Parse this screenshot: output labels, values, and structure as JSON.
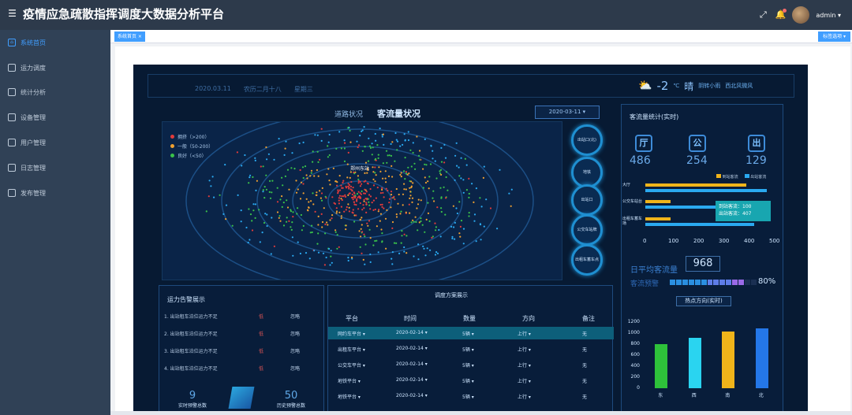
{
  "header": {
    "menu_icon": "hamburger-icon",
    "title": "疫情应急疏散指挥调度大数据分析平台",
    "user": "admin ▾",
    "icons": [
      "fullscreen-icon",
      "bell-icon",
      "avatar"
    ]
  },
  "sidebar": {
    "items": [
      {
        "label": "系统首页",
        "icon": "home-icon",
        "active": true
      },
      {
        "label": "运力调度",
        "icon": "transport-icon"
      },
      {
        "label": "统计分析",
        "icon": "stats-icon"
      },
      {
        "label": "设备管理",
        "icon": "device-icon"
      },
      {
        "label": "用户管理",
        "icon": "user-icon"
      },
      {
        "label": "日志管理",
        "icon": "log-icon"
      },
      {
        "label": "发布管理",
        "icon": "publish-icon"
      }
    ]
  },
  "tabs": {
    "home": "系统首页 ×",
    "close_label": "标签选项 ▾"
  },
  "dashboard": {
    "date": "2020.03.11",
    "lunar": "农历二月十八",
    "weekday": "星期三",
    "weather": {
      "temp": "-2",
      "unit": "℃",
      "cond": "晴",
      "extra1": "阴转小雨",
      "extra2": "西北风微风"
    },
    "tab_road": "道路状况",
    "tab_passenger": "客流量状况",
    "date_select": "2020-03-11 ▾",
    "map_label": "郑州东站",
    "map_legend": [
      {
        "label": "拥挤（>200）",
        "color": "#e23b3b"
      },
      {
        "label": "一般（50-200）",
        "color": "#f0a030"
      },
      {
        "label": "良好（<50）",
        "color": "#3ac24a"
      }
    ],
    "stations": [
      "出站口(北)",
      "地铁",
      "出站口",
      "公交车站牌",
      "出租车蓄车点"
    ],
    "right": {
      "title": "客流量统计(实时)",
      "cats": [
        {
          "icon": "厅",
          "value": "486"
        },
        {
          "icon": "公",
          "value": "254"
        },
        {
          "icon": "出",
          "value": "129"
        }
      ],
      "bar_legend": [
        "到站客流",
        "出站客流"
      ],
      "bar_labels": [
        "大厅",
        "公交车站台",
        "出租车蓄车场"
      ],
      "tooltip": [
        "到站客流：100",
        "出站客流：407"
      ],
      "xticks": [
        "0",
        "100",
        "200",
        "300",
        "400",
        "500"
      ],
      "daily_label": "日平均客流量",
      "daily_value": "968",
      "warn_label": "客流预警",
      "warn_pct": "80%",
      "hot_title": "热点方向(实时)",
      "col_yticks": [
        "1200",
        "1000",
        "800",
        "600",
        "400",
        "200",
        "0"
      ],
      "col_cats": [
        "东",
        "西",
        "南",
        "北"
      ],
      "col_values": [
        800,
        920,
        1030,
        1080
      ],
      "col_colors": [
        "#2ec23a",
        "#2ad4f0",
        "#f0b41a",
        "#2477e8"
      ]
    },
    "alarm": {
      "title": "运力告警展示",
      "rows": [
        {
          "t": "1. 出站租车泊位运力不足",
          "l": "低",
          "s": "忽略"
        },
        {
          "t": "2. 出站租车泊位运力不足",
          "l": "低",
          "s": "忽略"
        },
        {
          "t": "3. 出站租车泊位运力不足",
          "l": "低",
          "s": "忽略"
        },
        {
          "t": "4. 出站租车泊位运力不足",
          "l": "低",
          "s": "忽略"
        }
      ],
      "realtime_num": "9",
      "realtime_label": "实时预警总数",
      "history_num": "50",
      "history_label": "历史预警总数"
    },
    "schedule": {
      "title": "调度方案展示",
      "headers": [
        "平台",
        "时间",
        "数量",
        "方向",
        "备注"
      ],
      "rows": [
        [
          "网约车平台 ▾",
          "2020-02-14 ▾",
          "5辆 ▾",
          "上行 ▾",
          "无"
        ],
        [
          "出租车平台 ▾",
          "2020-02-14 ▾",
          "5辆 ▾",
          "上行 ▾",
          "无"
        ],
        [
          "公交车平台 ▾",
          "2020-02-14 ▾",
          "5辆 ▾",
          "上行 ▾",
          "无"
        ],
        [
          "地铁平台 ▾",
          "2020-02-14 ▾",
          "5辆 ▾",
          "上行 ▾",
          "无"
        ],
        [
          "地铁平台 ▾",
          "2020-02-14 ▾",
          "5辆 ▾",
          "上行 ▾",
          "无"
        ]
      ]
    }
  },
  "chart_data": [
    {
      "type": "bar",
      "title": "客流量统计(实时)",
      "categories": [
        "大厅",
        "公交车站台",
        "出租车蓄车场"
      ],
      "series": [
        {
          "name": "到站客流",
          "values": [
            400,
            100,
            100
          ]
        },
        {
          "name": "出站客流",
          "values": [
            480,
            407,
            430
          ]
        }
      ],
      "xlim": [
        0,
        500
      ],
      "orientation": "horizontal"
    },
    {
      "type": "bar",
      "title": "热点方向(实时)",
      "categories": [
        "东",
        "西",
        "南",
        "北"
      ],
      "values": [
        800,
        920,
        1030,
        1080
      ],
      "ylim": [
        0,
        1200
      ]
    }
  ]
}
